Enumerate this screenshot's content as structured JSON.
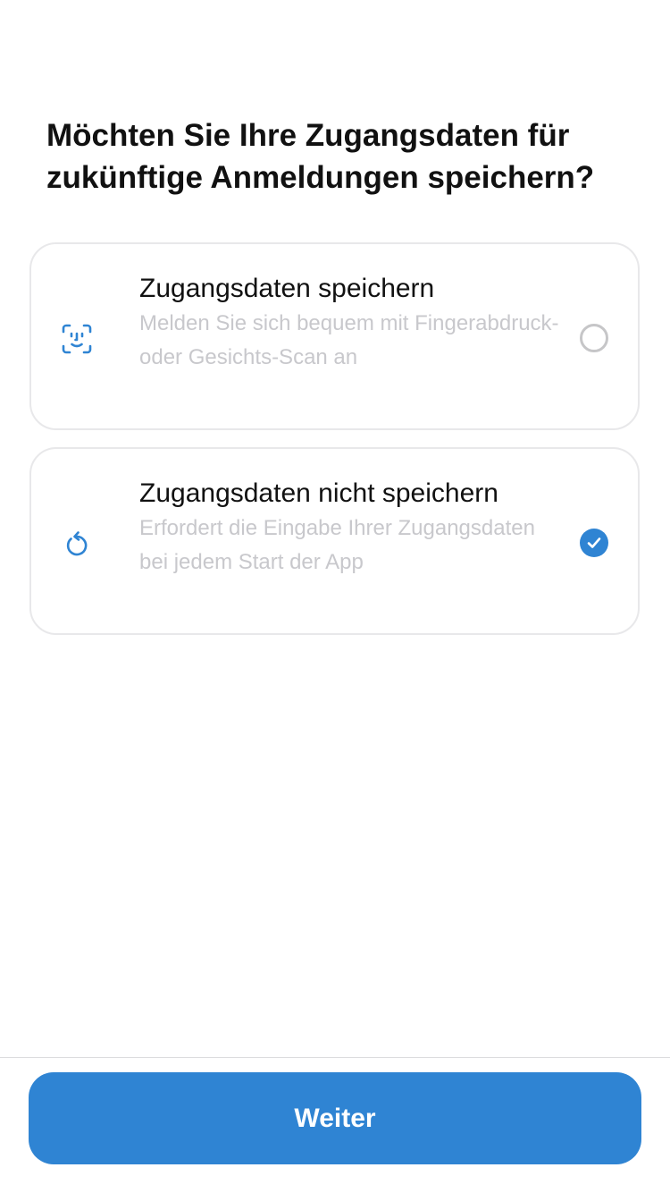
{
  "question": "Möchten Sie Ihre Zugangsdaten für zukünftige Anmeldungen speichern?",
  "options": [
    {
      "title": "Zugangsdaten speichern",
      "description": "Melden Sie sich bequem mit Fingerabdruck- oder Gesichts-Scan an",
      "icon": "face-id-icon",
      "selected": false
    },
    {
      "title": "Zugangsdaten nicht speichern",
      "description": "Erfordert die Eingabe Ihrer Zugangsdaten bei jedem Start der App",
      "icon": "rotate-left-icon",
      "selected": true
    }
  ],
  "footer": {
    "continue_label": "Weiter"
  },
  "colors": {
    "accent": "#2f84d3",
    "title_text": "#111111",
    "description_text": "#c8c8cc",
    "card_border": "#e8e8ea"
  }
}
